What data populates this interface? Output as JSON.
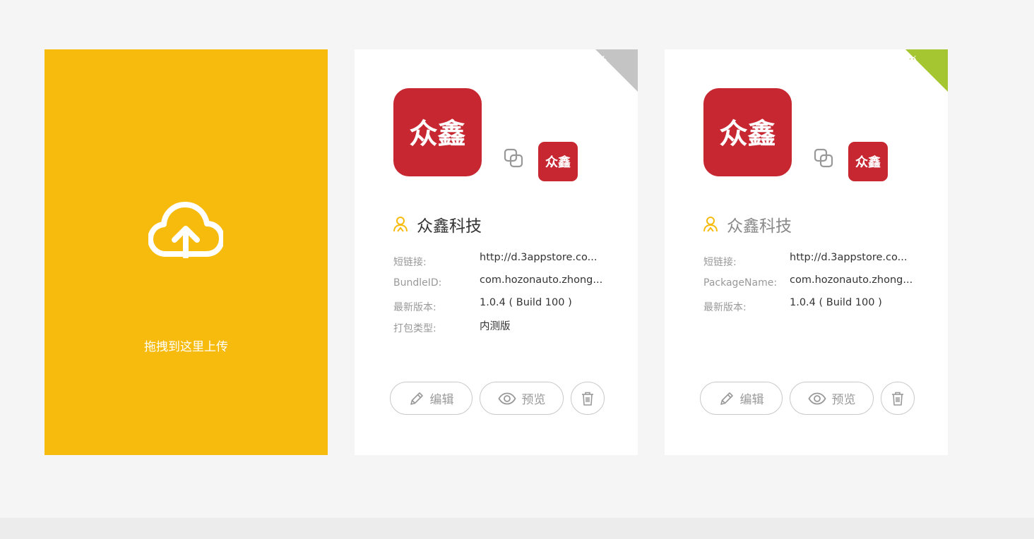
{
  "upload": {
    "label": "拖拽到这里上传",
    "icon": "cloud-upload-icon",
    "color": "#f7bb0d"
  },
  "logo_text": "众鑫",
  "apps": [
    {
      "platform": "ios",
      "platform_icon": "apple-icon",
      "corner_color": "#c4c4c4",
      "name": "众鑫科技",
      "fields": [
        {
          "label": "短链接:",
          "value": "http://d.3appstore.co..."
        },
        {
          "label": "BundleID:",
          "value": "com.hozonauto.zhong..."
        },
        {
          "label": "最新版本:",
          "value": "1.0.4 ( Build 100 )"
        },
        {
          "label": "打包类型:",
          "value": "内测版"
        }
      ],
      "buttons": {
        "edit": "编辑",
        "preview": "预览"
      }
    },
    {
      "platform": "android",
      "platform_icon": "android-icon",
      "corner_color": "#a5c531",
      "name": "众鑫科技",
      "fields": [
        {
          "label": "短链接:",
          "value": "http://d.3appstore.co..."
        },
        {
          "label": "PackageName:",
          "value": "com.hozonauto.zhong..."
        },
        {
          "label": "最新版本:",
          "value": "1.0.4 ( Build 100 )"
        }
      ],
      "buttons": {
        "edit": "编辑",
        "preview": "预览"
      }
    }
  ],
  "colors": {
    "brand_red": "#c62731",
    "accent_yellow": "#f7bb0d",
    "background": "#f5f5f5"
  }
}
